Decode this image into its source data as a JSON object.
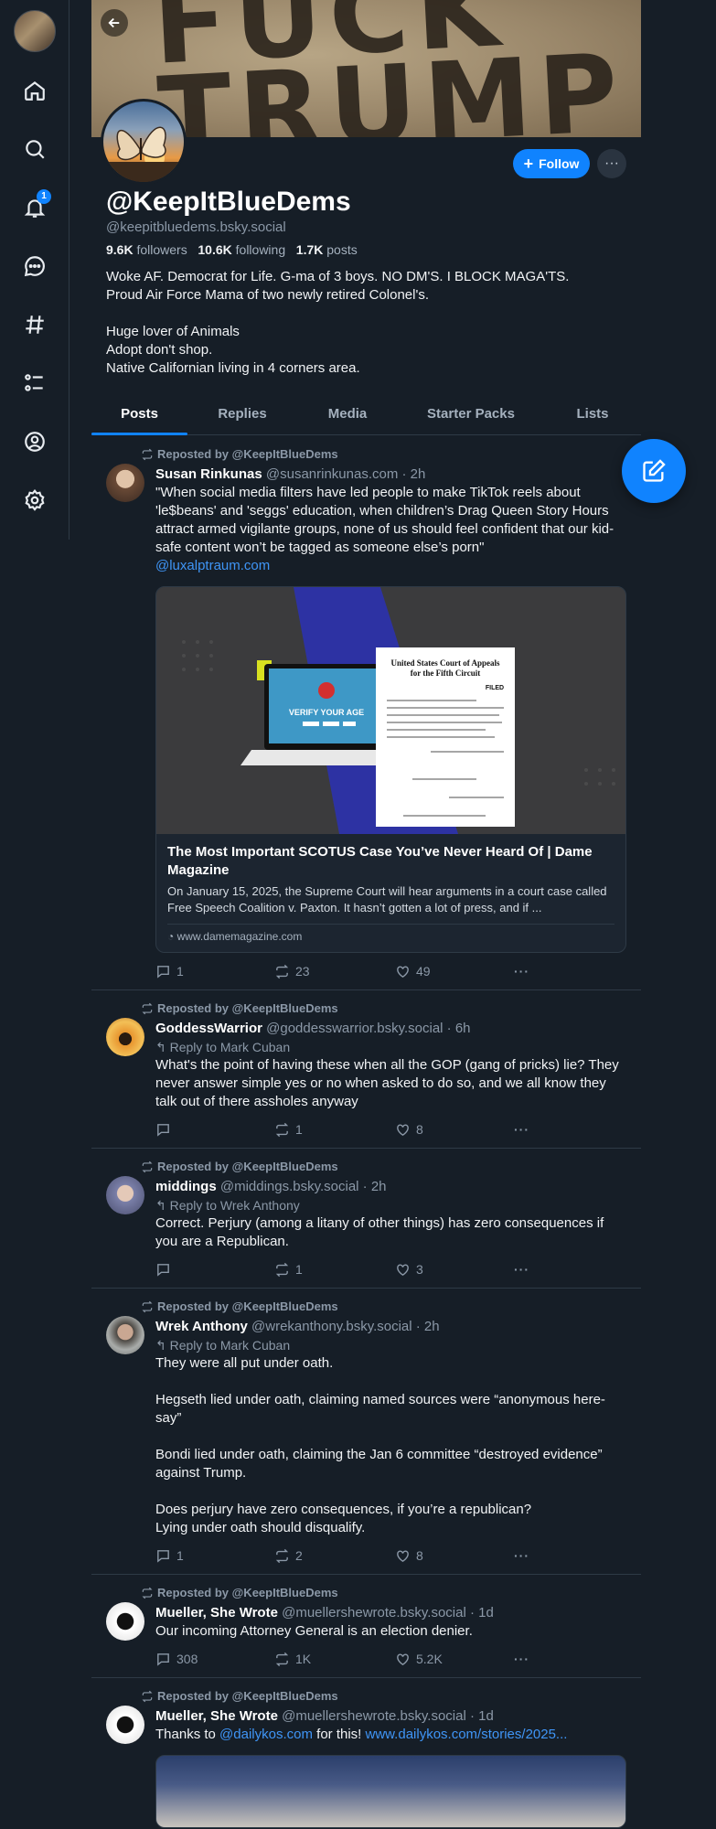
{
  "nav": {
    "notification_count": "1",
    "items": [
      "home-icon",
      "search-icon",
      "bell-icon",
      "chat-icon",
      "hashtag-icon",
      "list-icon",
      "profile-icon",
      "gear-icon"
    ]
  },
  "profile": {
    "banner_text": "FUCK TRUMP",
    "display_name": "@KeepItBlueDems",
    "handle": "@keepitbluedems.bsky.social",
    "followers_count": "9.6K",
    "followers_label": "followers",
    "following_count": "10.6K",
    "following_label": "following",
    "posts_count": "1.7K",
    "posts_label": "posts",
    "follow_label": "Follow",
    "more_label": "···",
    "bio": [
      "Woke AF. Democrat for Life. G-ma of 3 boys. NO DM'S. I BLOCK MAGA'TS.",
      "Proud Air Force Mama of two newly retired Colonel's.",
      "",
      "Huge lover of Animals",
      "Adopt don't shop.",
      "Native Californian living in 4 corners area."
    ]
  },
  "tabs": [
    "Posts",
    "Replies",
    "Media",
    "Starter Packs",
    "Lists"
  ],
  "posts": [
    {
      "repost": "Reposted by @KeepItBlueDems",
      "name": "Susan Rinkunas",
      "meta": "@susanrinkunas.com · 2h",
      "reply_to": "",
      "text": [
        "\"When social media filters have led people to make TikTok reels about 'le$beans' and 'seggs' education, when children’s Drag Queen Story Hours attract armed vigilante groups, none of us should feel confident that our kid-safe content won’t be tagged as someone else’s porn\""
      ],
      "link": "@luxalptraum.com",
      "embed": {
        "image_label": "VERIFY YOUR AGE",
        "doc_title": "United States Court of Appeals for the Fifth Circuit",
        "doc_stamp": "FILED",
        "title": "The Most Important SCOTUS Case You’ve Never Heard Of | Dame Magazine",
        "desc": "On January 15, 2025, the Supreme Court will hear arguments in a court case called Free Speech Coalition v. Paxton. It hasn’t gotten a lot of press, and if ...",
        "domain": "www.damemagazine.com"
      },
      "replies": "1",
      "reposts": "23",
      "likes": "49"
    },
    {
      "repost": "Reposted by @KeepItBlueDems",
      "name": "GoddessWarrior",
      "meta": "@goddesswarrior.bsky.social · 6h",
      "reply_to": "Reply to Mark Cuban",
      "text": [
        "What's the point of having these when all the GOP (gang of pricks) lie? They never answer simple yes or no when asked to do so, and we all know they talk out of there assholes anyway"
      ],
      "replies": "",
      "reposts": "1",
      "likes": "8"
    },
    {
      "repost": "Reposted by @KeepItBlueDems",
      "name": "middings",
      "meta": "@middings.bsky.social · 2h",
      "reply_to": "Reply to Wrek Anthony",
      "text": [
        "Correct. Perjury (among a litany of other things) has zero consequences if you are a Republican."
      ],
      "replies": "",
      "reposts": "1",
      "likes": "3"
    },
    {
      "repost": "Reposted by @KeepItBlueDems",
      "name": "Wrek Anthony",
      "meta": "@wrekanthony.bsky.social · 2h",
      "reply_to": "Reply to Mark Cuban",
      "text": [
        "They were all put under oath.",
        "",
        "Hegseth lied under oath, claiming named sources were “anonymous here-say”",
        "",
        "Bondi lied under oath, claiming the Jan 6 committee “destroyed evidence” against Trump.",
        "",
        "Does perjury have zero consequences, if you’re a republican?",
        "Lying under oath should disqualify."
      ],
      "replies": "1",
      "reposts": "2",
      "likes": "8"
    },
    {
      "repost": "Reposted by @KeepItBlueDems",
      "name": "Mueller, She Wrote",
      "meta": "@muellershewrote.bsky.social · 1d",
      "reply_to": "",
      "text": [
        "Our incoming Attorney General is an election denier."
      ],
      "replies": "308",
      "reposts": "1K",
      "likes": "5.2K"
    },
    {
      "repost": "Reposted by @KeepItBlueDems",
      "name": "Mueller, She Wrote",
      "meta": "@muellershewrote.bsky.social · 1d",
      "text_before": "Thanks to ",
      "link1": "@dailykos.com",
      "text_mid": " for this! ",
      "link2": "www.dailykos.com/stories/2025..."
    }
  ],
  "colors": {
    "accent": "#1083fe",
    "background": "#161e27",
    "link": "#3f95f6"
  }
}
